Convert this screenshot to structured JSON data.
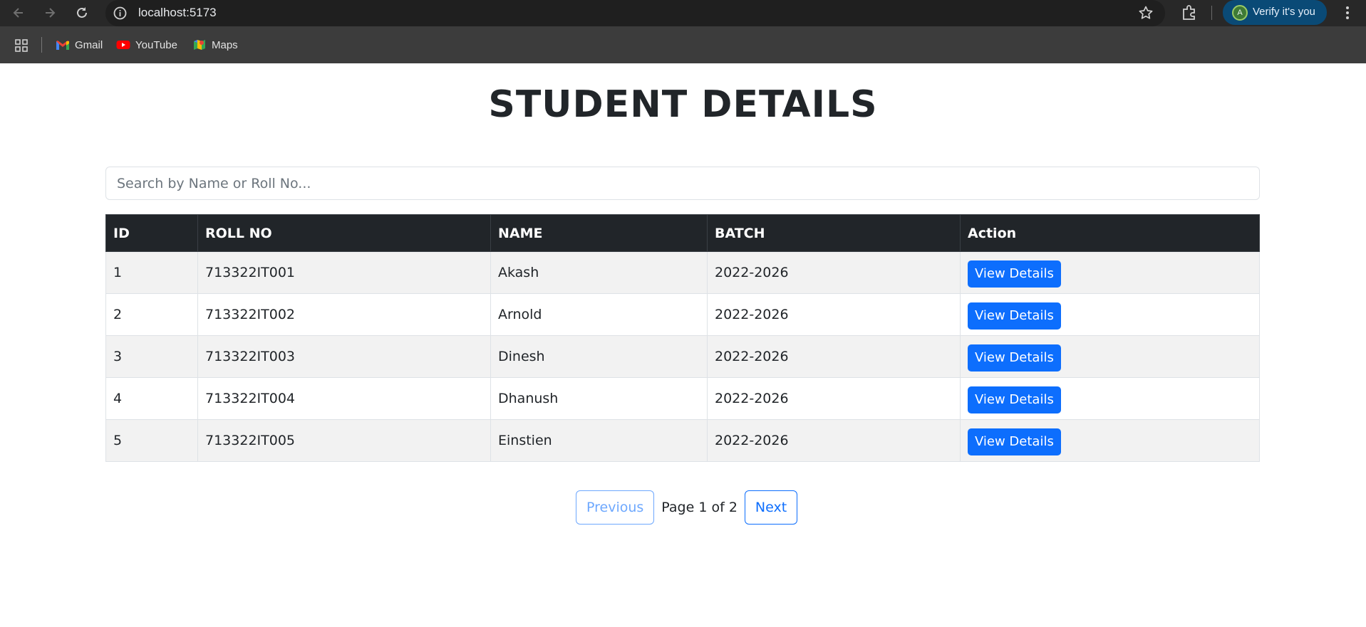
{
  "browser": {
    "url": "localhost:5173",
    "profile_label": "Verify it's you",
    "profile_initial": "A",
    "bookmarks": [
      {
        "label": "Gmail",
        "icon": "gmail-icon"
      },
      {
        "label": "YouTube",
        "icon": "youtube-icon"
      },
      {
        "label": "Maps",
        "icon": "maps-icon"
      }
    ]
  },
  "page": {
    "title": "STUDENT DETAILS",
    "search_placeholder": "Search by Name or Roll No..."
  },
  "table": {
    "headers": [
      "ID",
      "ROLL NO",
      "NAME",
      "BATCH",
      "Action"
    ],
    "rows": [
      {
        "id": "1",
        "roll": "713322IT001",
        "name": "Akash",
        "batch": "2022-2026",
        "action": "View Details"
      },
      {
        "id": "2",
        "roll": "713322IT002",
        "name": "Arnold",
        "batch": "2022-2026",
        "action": "View Details"
      },
      {
        "id": "3",
        "roll": "713322IT003",
        "name": "Dinesh",
        "batch": "2022-2026",
        "action": "View Details"
      },
      {
        "id": "4",
        "roll": "713322IT004",
        "name": "Dhanush",
        "batch": "2022-2026",
        "action": "View Details"
      },
      {
        "id": "5",
        "roll": "713322IT005",
        "name": "Einstien",
        "batch": "2022-2026",
        "action": "View Details"
      }
    ]
  },
  "pagination": {
    "previous_label": "Previous",
    "page_info": "Page 1 of 2",
    "next_label": "Next"
  },
  "colors": {
    "header_bg": "#212529",
    "primary": "#0d6efd",
    "stripe": "#f2f2f2"
  }
}
